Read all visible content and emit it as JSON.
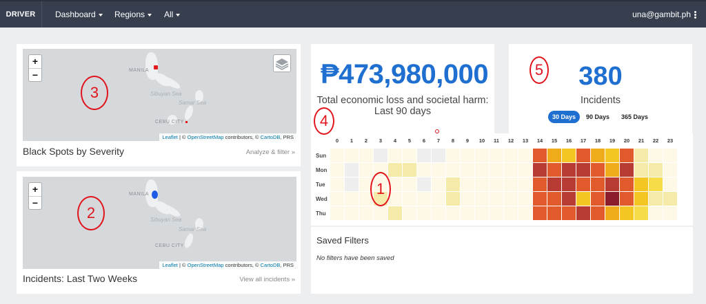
{
  "navbar": {
    "brand": "DRIVER",
    "menus": [
      {
        "label": "Dashboard"
      },
      {
        "label": "Regions"
      },
      {
        "label": "All"
      }
    ],
    "user": "una@gambit.ph"
  },
  "map1": {
    "zoom_in": "+",
    "zoom_out": "−",
    "labels": {
      "manila": "MANILA",
      "cebu": "CEBU CITY",
      "sibuyan": "Sibuyan Sea",
      "samar": "Samar Sea"
    },
    "attribution": {
      "leaflet": "Leaflet",
      "sep": " | © ",
      "osm": "OpenStreetMap",
      "contrib": " contributors, © ",
      "carto": "CartoDB",
      "prs": ", PRS"
    },
    "title": "Black Spots by Severity",
    "link": "Analyze & filter »"
  },
  "map2": {
    "zoom_in": "+",
    "zoom_out": "−",
    "labels": {
      "manila": "MANILA",
      "cebu": "CEBU CITY",
      "sibuyan": "Sibuyan Sea",
      "samar": "Samar Sea"
    },
    "attribution": {
      "leaflet": "Leaflet",
      "sep": " | © ",
      "osm": "OpenStreetMap",
      "contrib": " contributors, © ",
      "carto": "CartoDB",
      "prs": ", PRS"
    },
    "title": "Incidents: Last Two Weeks",
    "link": "View all incidents »"
  },
  "annotations": [
    "1",
    "2",
    "3",
    "4",
    "5"
  ],
  "economic": {
    "amount": "₱473,980,000",
    "label": "Total economic loss and societal harm: Last 90 days"
  },
  "incidents": {
    "count": "380",
    "label": "Incidents",
    "ranges": [
      {
        "label": "30 Days",
        "active": true
      },
      {
        "label": "90 Days",
        "active": false
      },
      {
        "label": "365 Days",
        "active": false
      }
    ]
  },
  "heatmap": {
    "hours": [
      "0",
      "1",
      "2",
      "3",
      "4",
      "5",
      "6",
      "7",
      "8",
      "9",
      "10",
      "11",
      "12",
      "13",
      "14",
      "15",
      "16",
      "17",
      "18",
      "19",
      "20",
      "21",
      "22",
      "23"
    ],
    "days": [
      "Sun",
      "Mon",
      "Tue",
      "Wed",
      "Thu"
    ],
    "levels": [
      [
        1,
        1,
        1,
        9,
        1,
        1,
        9,
        9,
        1,
        1,
        1,
        1,
        1,
        1,
        6,
        5,
        4,
        6,
        5,
        4,
        6,
        2,
        1,
        1
      ],
      [
        1,
        9,
        1,
        1,
        2,
        2,
        1,
        1,
        1,
        1,
        1,
        1,
        1,
        1,
        7,
        6,
        7,
        7,
        6,
        5,
        7,
        2,
        2,
        1
      ],
      [
        1,
        9,
        1,
        1,
        1,
        1,
        9,
        1,
        2,
        1,
        1,
        1,
        1,
        1,
        6,
        7,
        7,
        6,
        6,
        7,
        6,
        4,
        3,
        1
      ],
      [
        1,
        1,
        1,
        2,
        1,
        1,
        1,
        1,
        2,
        1,
        1,
        1,
        1,
        1,
        6,
        6,
        7,
        4,
        6,
        8,
        6,
        4,
        2,
        2
      ],
      [
        1,
        1,
        1,
        1,
        2,
        1,
        1,
        1,
        1,
        1,
        1,
        1,
        1,
        1,
        6,
        6,
        6,
        7,
        6,
        5,
        4,
        3,
        1,
        1
      ]
    ],
    "palette": {
      "0": "#ffffff",
      "1": "#fdf9e6",
      "2": "#f6eaa8",
      "3": "#f5dc48",
      "4": "#f3c623",
      "5": "#f0ab1b",
      "6": "#e05a2b",
      "7": "#b73a33",
      "8": "#8a1e2c",
      "9": "#eeeeee"
    }
  },
  "saved_filters": {
    "title": "Saved Filters",
    "empty": "No filters have been saved"
  }
}
